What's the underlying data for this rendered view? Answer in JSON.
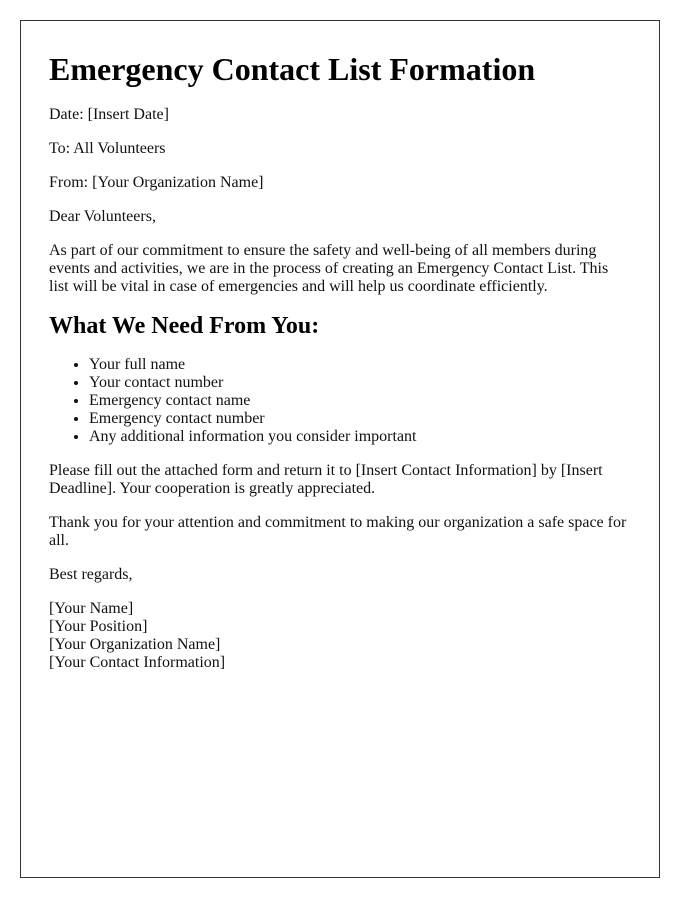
{
  "document": {
    "title": "Emergency Contact List Formation",
    "header_fields": [
      "Date: [Insert Date]",
      "To: All Volunteers",
      "From: [Your Organization Name]"
    ],
    "salutation": "Dear Volunteers,",
    "intro_paragraph": "As part of our commitment to ensure the safety and well-being of all members during events and activities, we are in the process of creating an Emergency Contact List. This list will be vital in case of emergencies and will help us coordinate efficiently.",
    "section_heading": "What We Need From You:",
    "requirements": [
      "Your full name",
      "Your contact number",
      "Emergency contact name",
      "Emergency contact number",
      "Any additional information you consider important"
    ],
    "instruction_paragraph": "Please fill out the attached form and return it to [Insert Contact Information] by [Insert Deadline]. Your cooperation is greatly appreciated.",
    "thanks_paragraph": "Thank you for your attention and commitment to making our organization a safe space for all.",
    "closing": "Best regards,",
    "signature": [
      "[Your Name]",
      "[Your Position]",
      "[Your Organization Name]",
      "[Your Contact Information]"
    ]
  }
}
